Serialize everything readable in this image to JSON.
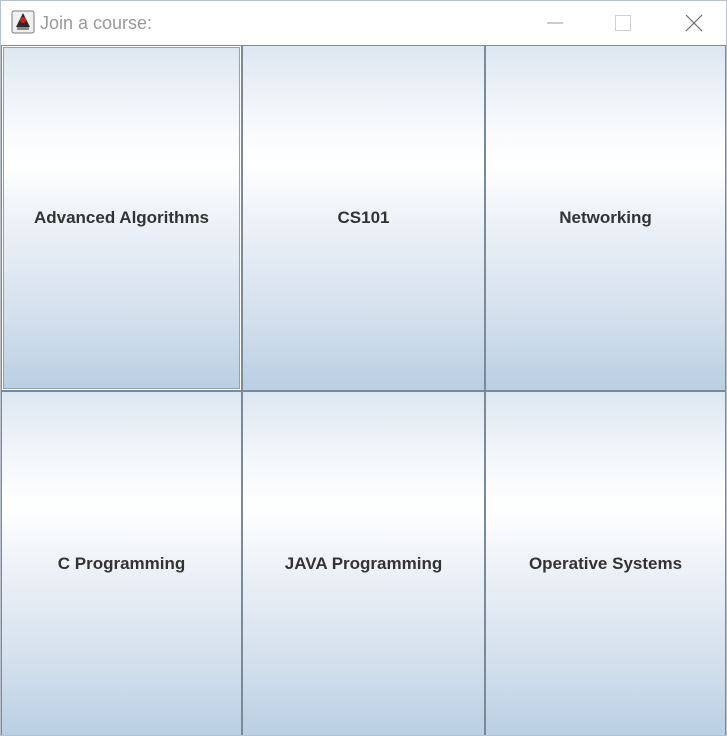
{
  "window": {
    "title": "Join a course:",
    "app_icon": "java-duke-icon",
    "controls": {
      "minimize_icon": "minimize-icon",
      "maximize_icon": "maximize-icon",
      "close_icon": "close-icon"
    }
  },
  "courses": [
    {
      "label": "Advanced Algorithms"
    },
    {
      "label": "CS101"
    },
    {
      "label": "Networking"
    },
    {
      "label": "C Programming"
    },
    {
      "label": "JAVA Programming"
    },
    {
      "label": "Operative Systems"
    }
  ],
  "colors": {
    "title_text": "#999999",
    "button_border": "#7a8a99",
    "button_gradient_top": "#dde7f1",
    "button_gradient_mid": "#ffffff",
    "button_gradient_bottom": "#b9cfe3",
    "label_text": "#333333"
  }
}
